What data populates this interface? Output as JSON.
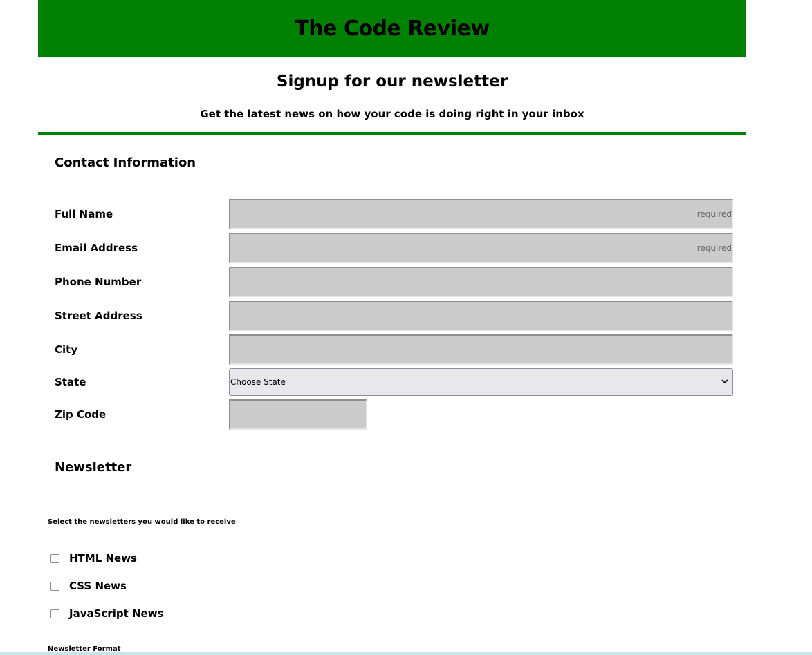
{
  "header": {
    "title": "The Code Review",
    "subtitle": "Signup for our newsletter",
    "tagline": "Get the latest news on how your code is doing right in your inbox"
  },
  "colors": {
    "brand_green": "#008000",
    "input_bg": "#cbcbcb",
    "select_bg": "#e8e8ec"
  },
  "contact": {
    "title": "Contact Information",
    "fields": [
      {
        "label": "Full Name",
        "value": "",
        "placeholder": "required"
      },
      {
        "label": "Email Address",
        "value": "",
        "placeholder": "required"
      },
      {
        "label": "Phone Number",
        "value": "",
        "placeholder": ""
      },
      {
        "label": "Street Address",
        "value": "",
        "placeholder": ""
      },
      {
        "label": "City",
        "value": "",
        "placeholder": ""
      }
    ],
    "state": {
      "label": "State",
      "selected": "Choose State",
      "icon": "chevron-down-icon",
      "glyph": "⌄"
    },
    "zip": {
      "label": "Zip Code",
      "value": "",
      "placeholder": ""
    }
  },
  "newsletter": {
    "title": "Newsletter",
    "instruction": "Select the newsletters you would like to receive",
    "options": [
      {
        "label": "HTML News",
        "checked": false
      },
      {
        "label": "CSS News",
        "checked": false
      },
      {
        "label": "JavaScript News",
        "checked": false
      }
    ],
    "format_label": "Newsletter Format"
  }
}
